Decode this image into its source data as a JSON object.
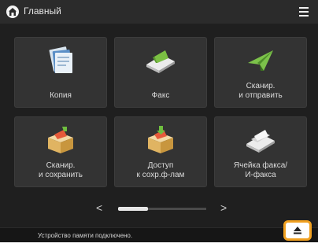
{
  "header": {
    "title": "Главный",
    "home_icon": "home-icon",
    "menu_icon": "menu-icon"
  },
  "tiles": [
    {
      "label": "Копия",
      "icon": "copy-icon"
    },
    {
      "label": "Факс",
      "icon": "fax-icon"
    },
    {
      "label": "Сканир.\nи отправить",
      "icon": "scan-send-icon"
    },
    {
      "label": "Сканир.\nи сохранить",
      "icon": "scan-save-icon"
    },
    {
      "label": "Доступ\nк сохр.ф-лам",
      "icon": "stored-files-icon"
    },
    {
      "label": "Ячейка факса/\nИ-факса",
      "icon": "fax-inbox-icon"
    }
  ],
  "pager": {
    "prev": "<",
    "next": ">",
    "prev_icon": "chevron-left-icon",
    "next_icon": "chevron-right-icon"
  },
  "status": {
    "message": "Устройство памяти подключено.",
    "eject_icon": "eject-icon"
  },
  "colors": {
    "background": "#1f1f1f",
    "tile": "#333333",
    "highlight": "#f0a020"
  }
}
